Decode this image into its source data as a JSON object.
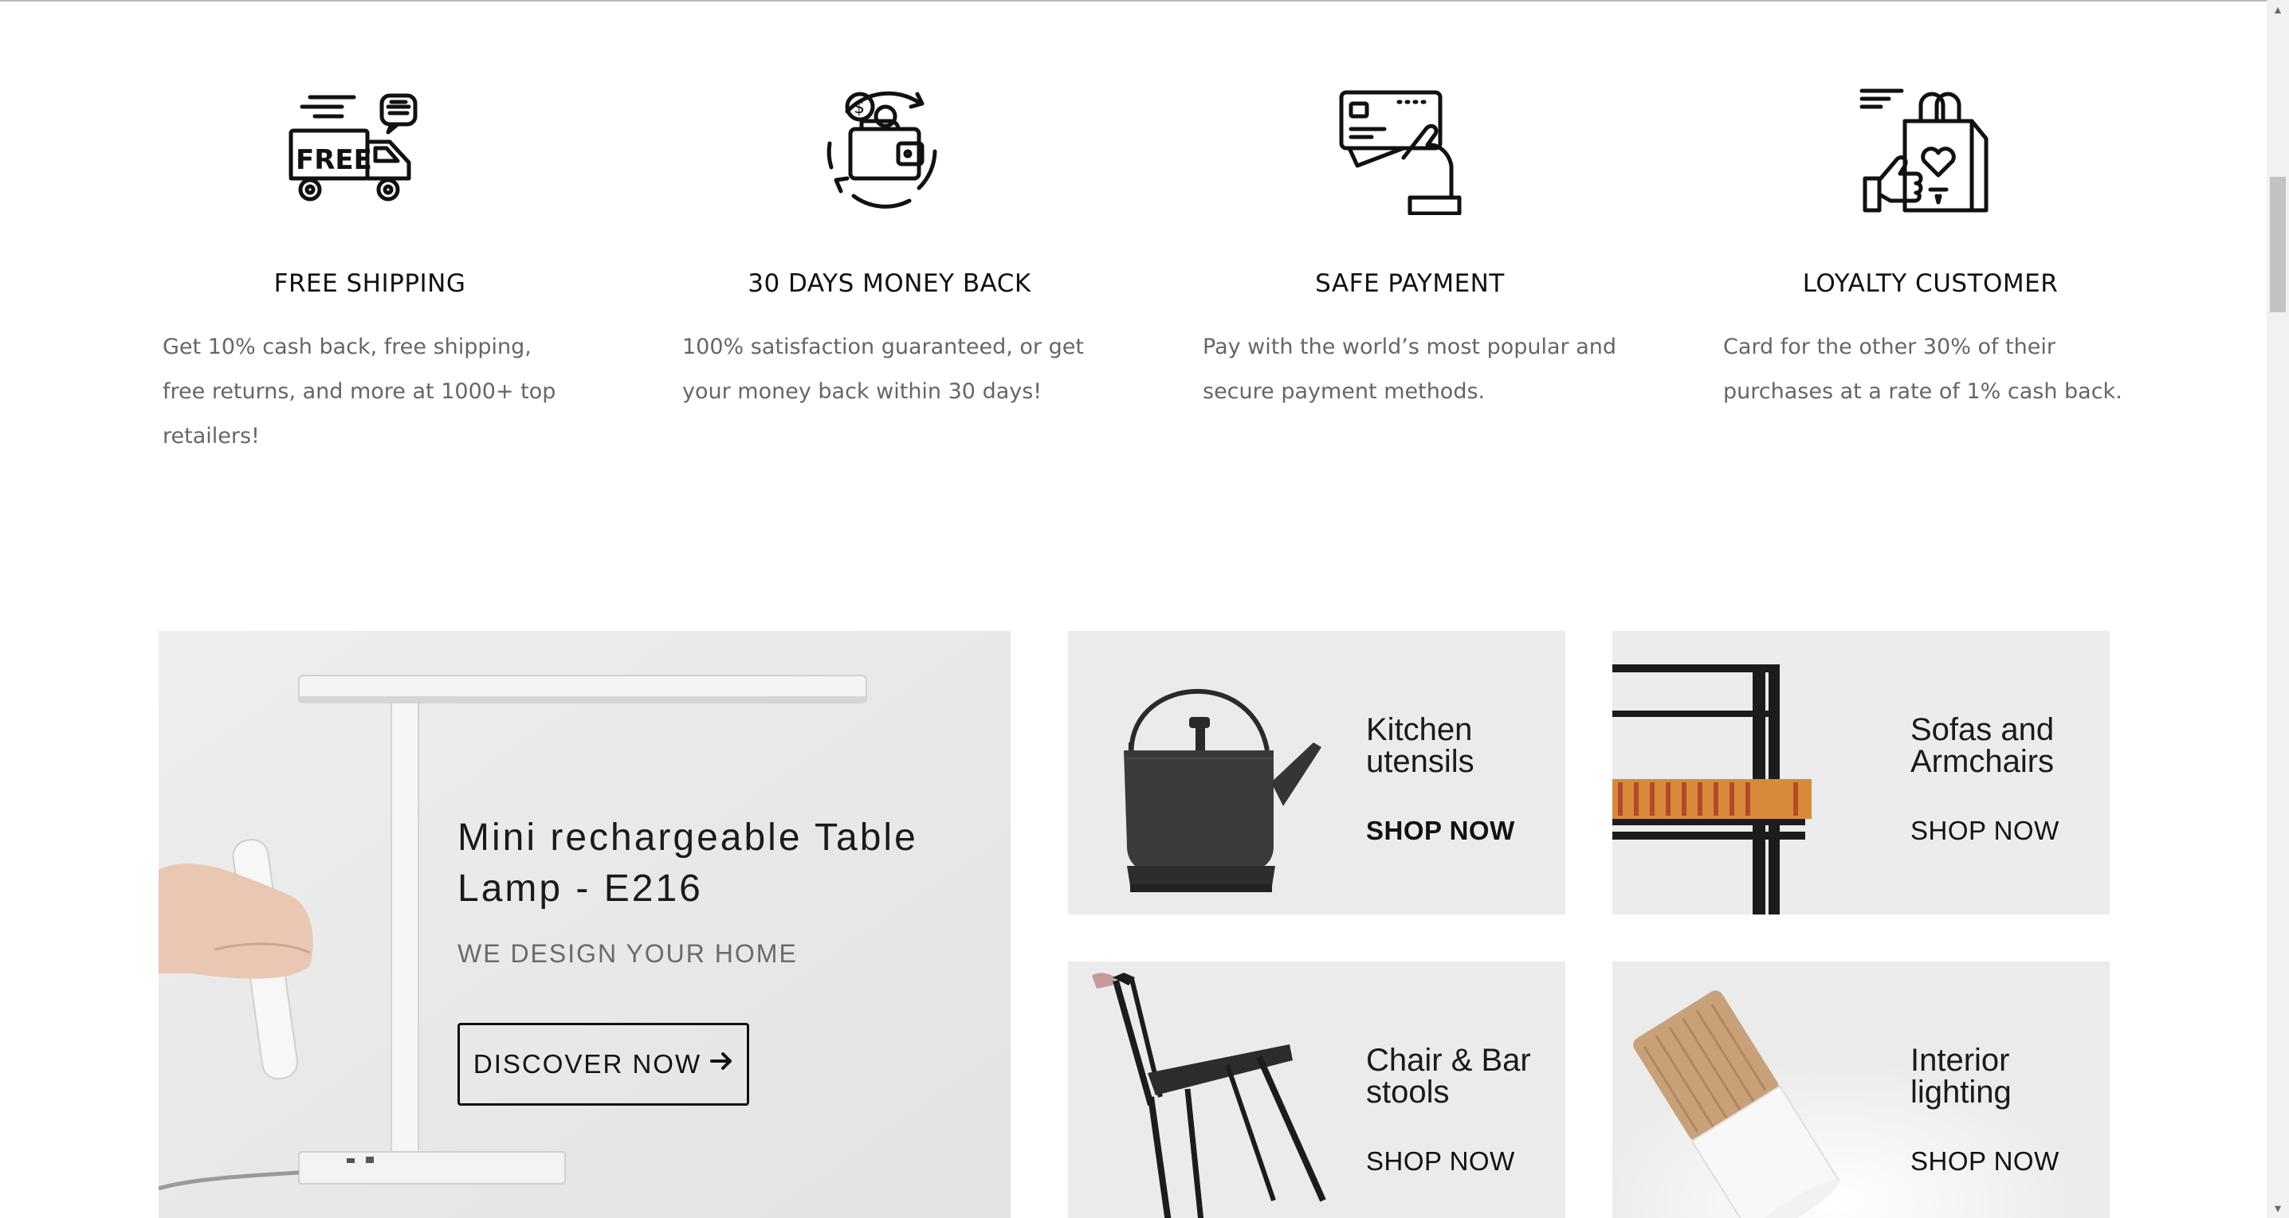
{
  "features": [
    {
      "icon": "free-shipping-truck-icon",
      "title": "FREE SHIPPING",
      "desc": "Get 10% cash back, free shipping, free returns, and more at 1000+ top retailers!",
      "icon_text": "FREE"
    },
    {
      "icon": "money-back-wallet-icon",
      "title": "30 DAYS MONEY BACK",
      "desc": "100% satisfaction guaranteed, or get your money back within 30 days!"
    },
    {
      "icon": "credit-card-hand-icon",
      "title": "SAFE PAYMENT",
      "desc": "Pay with the world’s most popular and secure payment methods."
    },
    {
      "icon": "shopping-bag-thumbs-up-icon",
      "title": "LOYALTY CUSTOMER",
      "desc": "Card for the other 30% of their purchases at a rate of 1% cash back."
    }
  ],
  "main_banner": {
    "title": "Mini rechargeable Table Lamp - E216",
    "subtitle": "WE DESIGN YOUR HOME",
    "button_label": "DISCOVER NOW",
    "button_icon": "arrow-right-icon"
  },
  "category_banners": [
    {
      "title": "Kitchen utensils",
      "cta": "SHOP NOW",
      "image": "kettle-image"
    },
    {
      "title": "Sofas and Armchairs",
      "cta": "SHOP NOW",
      "image": "bench-image"
    },
    {
      "title": "Chair & Bar stools",
      "cta": "SHOP NOW",
      "image": "chair-image"
    },
    {
      "title": "Interior lighting",
      "cta": "SHOP NOW",
      "image": "pendant-lamp-image"
    }
  ],
  "colors": {
    "text": "#111111",
    "muted": "#666666",
    "banner_bg": "#ebebeb"
  }
}
